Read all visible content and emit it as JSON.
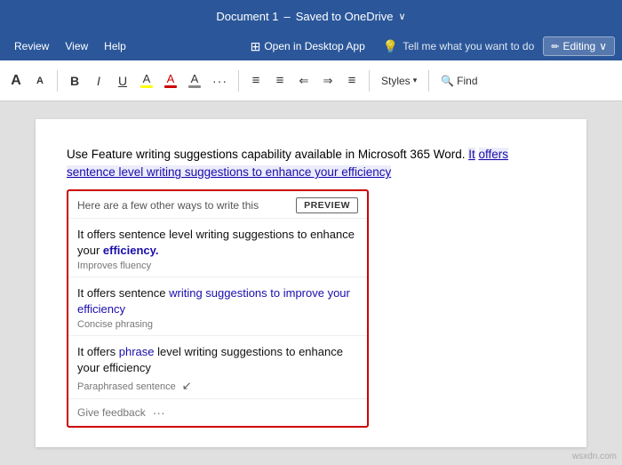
{
  "titleBar": {
    "docName": "Document 1",
    "separator": "–",
    "saveStatus": "Saved to OneDrive",
    "chevron": "∨"
  },
  "menuBar": {
    "items": [
      "Review",
      "View",
      "Help"
    ],
    "openDesktop": "Open in Desktop App",
    "tellMe": "Tell me what you want to do",
    "editing": "Editing",
    "chevron": "∨"
  },
  "ribbon": {
    "fontSizeA": "A",
    "fontSizeASmall": "A",
    "bold": "B",
    "italic": "I",
    "underline": "U",
    "more": "···",
    "list1": "≡",
    "list2": "≡",
    "indent1": "⇐",
    "indent2": "⇒",
    "align": "≡",
    "stylesLabel": "Styles",
    "findLabel": "Find",
    "findIcon": "🔍"
  },
  "document": {
    "mainText": "Use Feature writing suggestions capability available in Microsoft 365 Word.",
    "linkText": "It",
    "selectedText": " offers sentence level writing suggestions to enhance your efficiency"
  },
  "suggestionPanel": {
    "headerText": "Here are a few other ways to write this",
    "previewBtn": "PREVIEW",
    "suggestions": [
      {
        "text1": "It offers sentence level writing suggestions to enhance your ",
        "accent": "efficiency.",
        "tag": "Improves fluency"
      },
      {
        "text1": "It offers sentence ",
        "accent": "writing suggestions to improve your efficiency",
        "tag": "Concise phrasing"
      },
      {
        "text1": "It offers ",
        "accent": "phrase",
        "text2": " level writing suggestions to enhance your efficiency",
        "tag": "Paraphrased sentence"
      }
    ],
    "feedbackLabel": "Give feedback",
    "feedbackDots": "···"
  },
  "colors": {
    "brand": "#2b579a",
    "linkBlue": "#1a0dab",
    "borderRed": "#c00",
    "highlightYellow": "#ffff00",
    "highlightRed": "#c00"
  }
}
